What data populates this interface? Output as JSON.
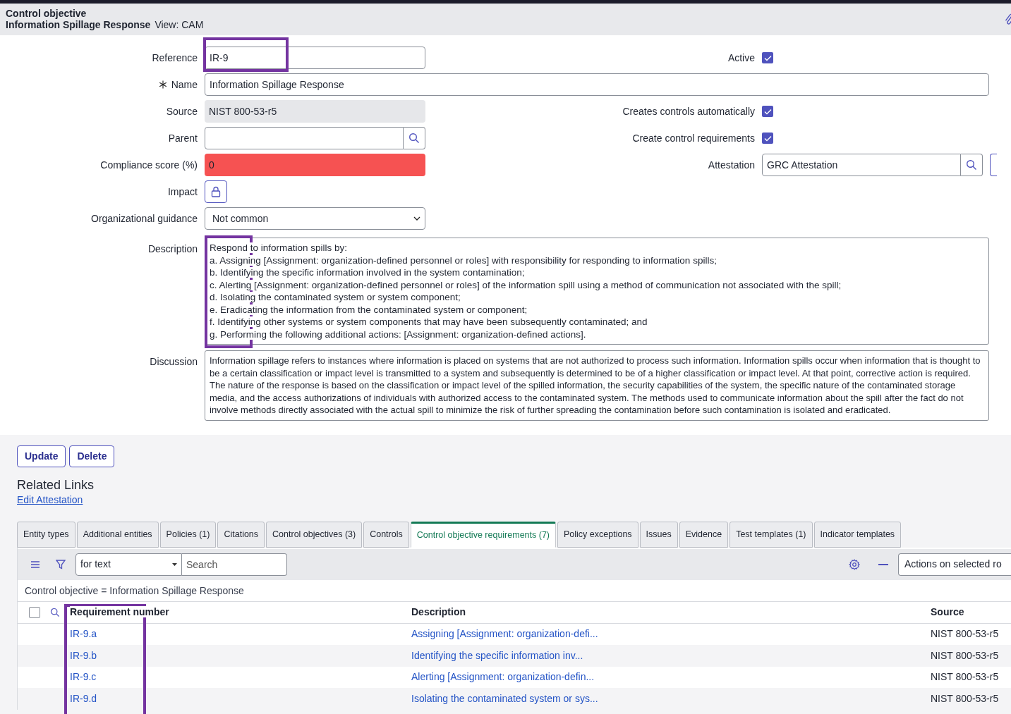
{
  "header": {
    "record_type": "Control objective",
    "record_name": "Information Spillage Response",
    "view": "View: CAM"
  },
  "form": {
    "rows": [
      {
        "left": {
          "label": "Reference",
          "kind": "text",
          "value": "IR-9"
        },
        "right": {
          "label": "Active",
          "kind": "checkbox",
          "checked": true
        }
      },
      {
        "left": {
          "label": "Name",
          "kind": "wide",
          "value": "Information Spillage Response",
          "required": true
        }
      },
      {
        "left": {
          "label": "Source",
          "kind": "readonly",
          "value": "NIST 800-53-r5"
        },
        "right": {
          "label": "Creates controls automatically",
          "kind": "checkbox",
          "checked": true
        }
      },
      {
        "left": {
          "label": "Parent",
          "kind": "lookup"
        },
        "right": {
          "label": "Create control requirements",
          "kind": "checkbox",
          "checked": true
        }
      },
      {
        "left": {
          "label": "Compliance score (%)",
          "kind": "score",
          "value": "0"
        },
        "right": {
          "label": "Attestation",
          "kind": "lookup",
          "value": "GRC Attestation"
        }
      },
      {
        "left": {
          "label": "Impact",
          "kind": "lock"
        }
      },
      {
        "left": {
          "label": "Organizational guidance",
          "kind": "select",
          "value": "Not common"
        }
      }
    ],
    "description": {
      "label": "Description",
      "lines": [
        "Respond to information spills by:",
        "a. Assigning [Assignment: organization-defined personnel or roles] with responsibility for responding to information spills;",
        "b. Identifying the specific information involved in the system contamination;",
        "c. Alerting [Assignment: organization-defined personnel or roles] of the information spill using a method of communication not associated with the spill;",
        "d. Isolating the contaminated system or system component;",
        "e. Eradicating the information from the contaminated system or component;",
        "f. Identifying other systems or system components that may have been subsequently contaminated; and",
        "g. Performing the following additional actions: [Assignment: organization-defined actions]."
      ]
    },
    "discussion": {
      "label": "Discussion",
      "text": "Information spillage refers to instances where information is placed on systems that are not authorized to process such information. Information spills occur when information that is thought to be a certain classification or impact level is transmitted to a system and subsequently is determined to be of a higher classification or impact level. At that point, corrective action is required. The nature of the response is based on the classification or impact level of the spilled information, the security capabilities of the system, the specific nature of the contaminated storage media, and the access authorizations of individuals with authorized access to the contaminated system. The methods used to communicate information about the spill after the fact do not involve methods directly associated with the actual spill to minimize the risk of further spreading the contamination before such contamination is isolated and eradicated."
    }
  },
  "buttons": [
    "Update",
    "Delete"
  ],
  "related_links": {
    "title": "Related Links",
    "links": [
      "Edit Attestation"
    ]
  },
  "tabs": [
    {
      "label": "Entity types",
      "selected": false
    },
    {
      "label": "Additional entities",
      "selected": false
    },
    {
      "label": "Policies (1)",
      "selected": false
    },
    {
      "label": "Citations",
      "selected": false
    },
    {
      "label": "Control objectives (3)",
      "selected": false
    },
    {
      "label": "Controls",
      "selected": false
    },
    {
      "label": "Control objective requirements (7)",
      "selected": true
    },
    {
      "label": "Policy exceptions",
      "selected": false
    },
    {
      "label": "Issues",
      "selected": false
    },
    {
      "label": "Evidence",
      "selected": false
    },
    {
      "label": "Test templates (1)",
      "selected": false
    },
    {
      "label": "Indicator templates",
      "selected": false
    }
  ],
  "list": {
    "select_all": {
      "checked": false
    },
    "search_type": "for text",
    "search": {
      "placeholder": "Search"
    },
    "actions": "Actions on selected ro",
    "filter": "Control objective = Information Spillage Response",
    "columns": [
      "Requirement number",
      "Description",
      "Source"
    ],
    "rows": [
      {
        "number": "IR-9.a",
        "description": "Assigning [Assignment: organization-defi...",
        "source": "NIST 800-53-r5"
      },
      {
        "number": "IR-9.b",
        "description": "Identifying the specific information inv...",
        "source": "NIST 800-53-r5"
      },
      {
        "number": "IR-9.c",
        "description": "Alerting [Assignment: organization-defin...",
        "source": "NIST 800-53-r5"
      },
      {
        "number": "IR-9.d",
        "description": "Isolating the contaminated system or sys...",
        "source": "NIST 800-53-r5"
      }
    ]
  }
}
